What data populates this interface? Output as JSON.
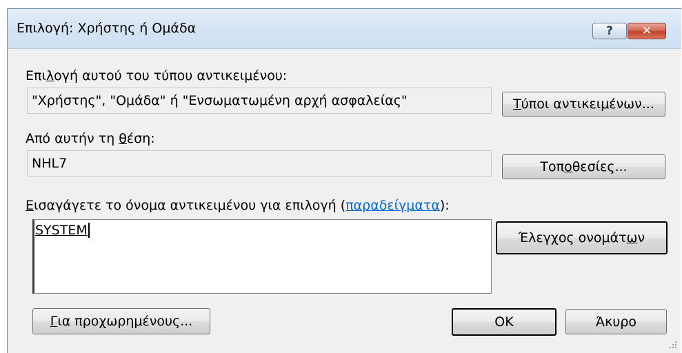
{
  "dialog": {
    "title": "Επιλογή: Χρήστης ή Ομάδα",
    "help_glyph": "?",
    "close_glyph": "✕"
  },
  "object_type": {
    "label_pre": "Επι",
    "label_key": "λ",
    "label_post": "ογή αυτού του τύπου αντικειμένου:",
    "value": "\"Χρήστης\", \"Ομάδα\" ή \"Ενσωματωμένη αρχή ασφαλείας\"",
    "button_key": "Τ",
    "button_rest": "ύποι αντικειμένων..."
  },
  "location": {
    "label_pre": "Από αυτήν τη ",
    "label_key": "θ",
    "label_post": "έση:",
    "value": "NHL7",
    "button_pre": "Τοπ",
    "button_key": "ο",
    "button_post": "θεσίες..."
  },
  "object_name": {
    "label_key": "Ε",
    "label_pre": "ισαγάγετε το όνομα αντικειμένου για επιλογή (",
    "link": "παραδείγματα",
    "label_post": "):",
    "value": "SYSTEM"
  },
  "check_names": {
    "button_pre": "Έλεγχος ονομάτ",
    "button_key": "ω",
    "button_post": "ν"
  },
  "footer": {
    "advanced_key": "Γ",
    "advanced_rest": "ια προχωρημένους...",
    "ok": "OK",
    "cancel": "Άκυρο"
  }
}
